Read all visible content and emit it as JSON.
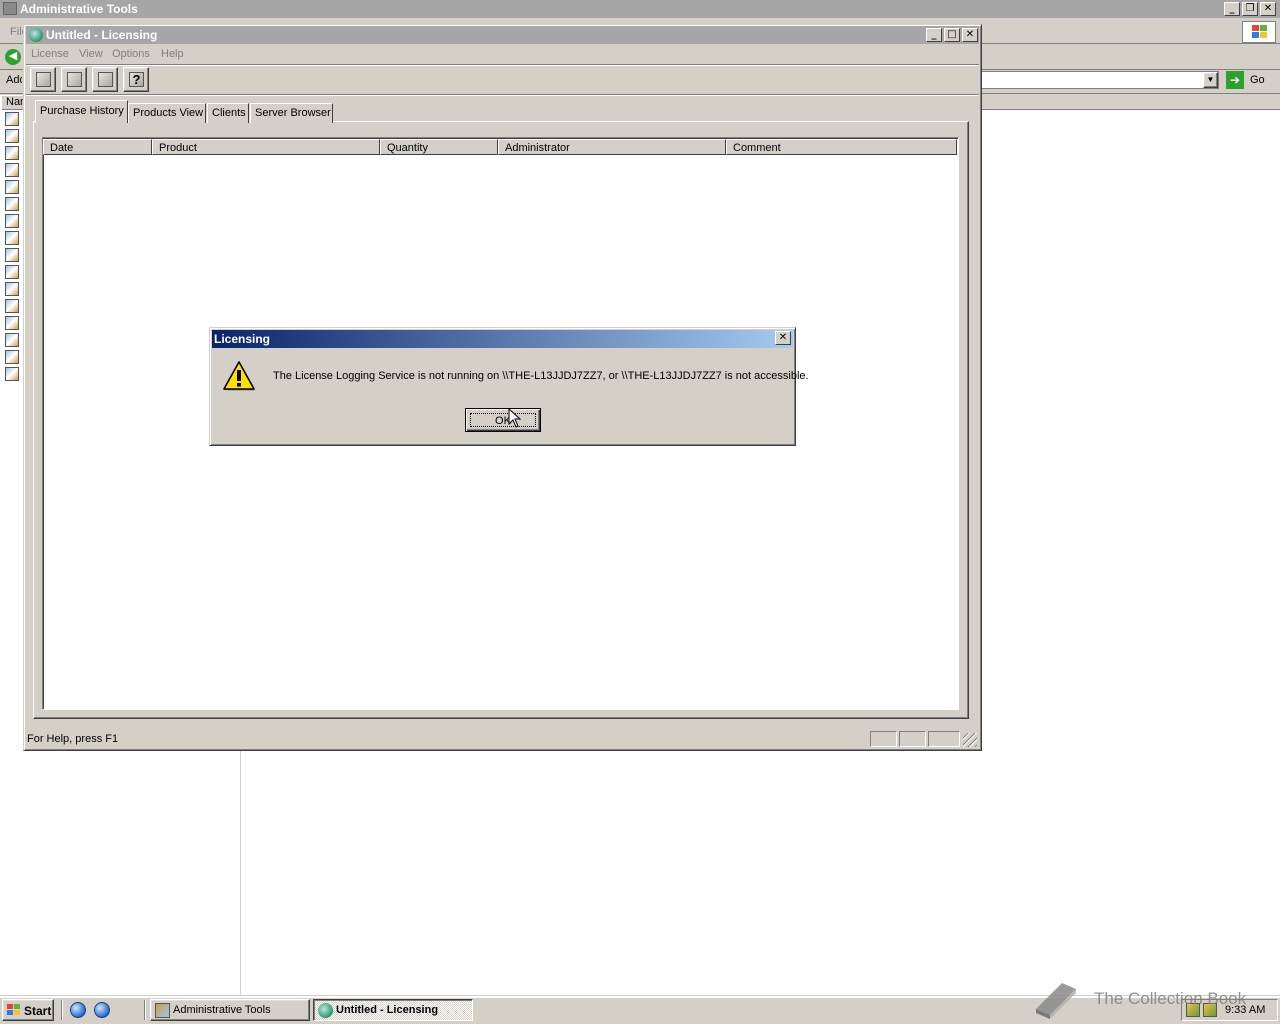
{
  "background_window": {
    "title": "Administrative Tools",
    "menu_first": "File",
    "address_label": "Address",
    "go_label": "Go",
    "left_pane_header": "Name"
  },
  "licensing_window": {
    "title": "Untitled - Licensing",
    "menu": [
      "License",
      "View",
      "Options",
      "Help"
    ],
    "toolbar_icons": [
      "select-domain-icon",
      "new-license-icon",
      "properties-icon",
      "help-icon"
    ],
    "tabs": [
      "Purchase History",
      "Products View",
      "Clients",
      "Server Browser"
    ],
    "active_tab": "Purchase History",
    "columns": [
      "Date",
      "Product",
      "Quantity",
      "Administrator",
      "Comment"
    ],
    "rows": [],
    "status_text": "For Help, press F1"
  },
  "dialog": {
    "title": "Licensing",
    "message": "The License Logging Service is not running on \\\\THE-L13JJDJ7ZZ7, or \\\\THE-L13JJDJ7ZZ7 is not accessible.",
    "ok_label": "OK",
    "icon": "warning-icon"
  },
  "taskbar": {
    "start_label": "Start",
    "tasks": [
      {
        "label": "Administrative Tools",
        "active": false
      },
      {
        "label": "Untitled - Licensing",
        "active": true
      }
    ],
    "clock": "9:33 AM"
  },
  "watermark": "The Collection Book",
  "colors": {
    "dialog_title_start": "#0a246a",
    "dialog_title_end": "#a6caf0",
    "inactive_title": "#a6a6a6",
    "face": "#d4d0c8"
  }
}
